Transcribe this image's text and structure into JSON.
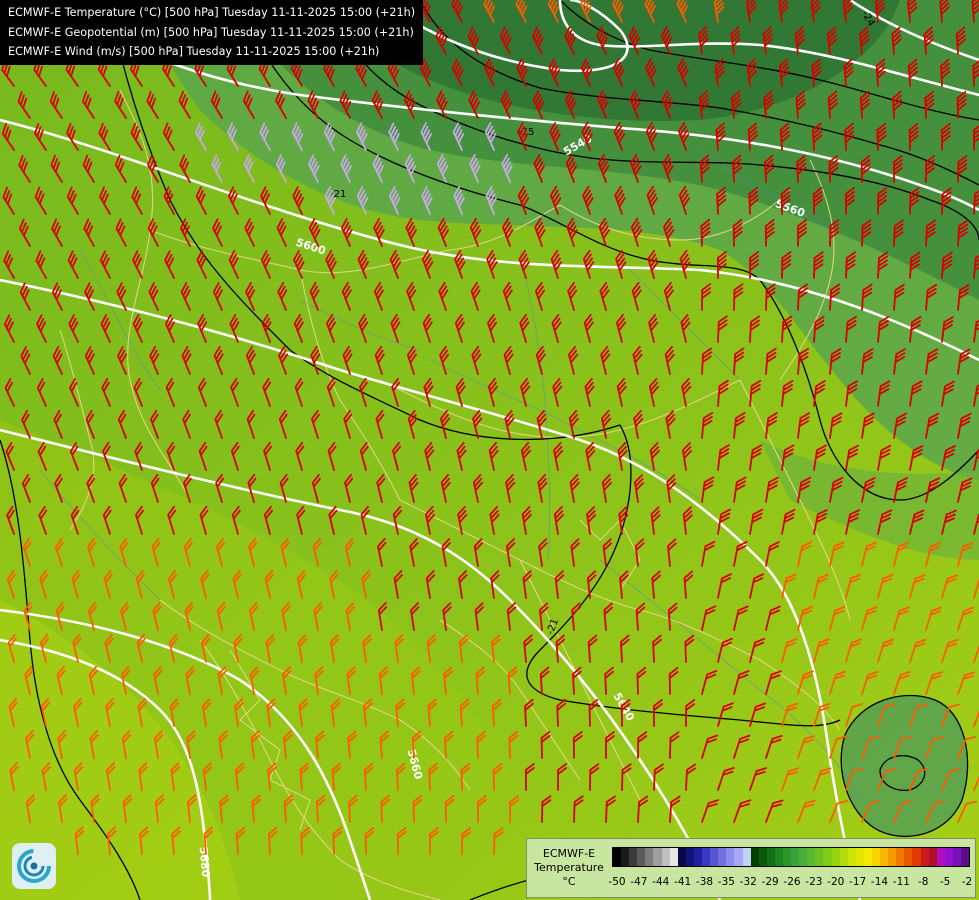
{
  "titles": [
    "ECMWF-E Temperature (°C) [500 hPa] Tuesday 11-11-2025 15:00 (+21h)",
    "ECMWF-E Geopotential (m) [500 hPa] Tuesday 11-11-2025 15:00 (+21h)",
    "ECMWF-E Wind (m/s) [500 hPa] Tuesday 11-11-2025 15:00 (+21h)"
  ],
  "contour_labels": {
    "geopotential": [
      "5540",
      "5560",
      "5600",
      "5640",
      "5660",
      "5680"
    ],
    "temperature": [
      "-21",
      "-25",
      "-24",
      "-21"
    ]
  },
  "legend": {
    "label_lines": [
      "ECMWF-E",
      "Temperature",
      "°C"
    ],
    "ticks": [
      "-50",
      "-47",
      "-44",
      "-41",
      "-38",
      "-35",
      "-32",
      "-29",
      "-26",
      "-23",
      "-20",
      "-17",
      "-14",
      "-11",
      "-8",
      "-5",
      "-2"
    ],
    "colors": [
      "#000000",
      "#1a1a1a",
      "#3a3a3a",
      "#5c5c5c",
      "#7d7d7d",
      "#9e9e9e",
      "#bfbfbf",
      "#e6e6e6",
      "#08084a",
      "#141478",
      "#2020a0",
      "#3838c0",
      "#5555d5",
      "#7070e0",
      "#8c8cec",
      "#a8a8f4",
      "#c0d4f8",
      "#004000",
      "#0a5a0a",
      "#137013",
      "#1e851e",
      "#2b972b",
      "#3aa33a",
      "#4aae3a",
      "#5ab82e",
      "#6ac224",
      "#7fcc18",
      "#98d410",
      "#b4dc0a",
      "#cce20a",
      "#e4e600",
      "#f2ea00",
      "#f8d400",
      "#f6b800",
      "#f49a00",
      "#f07a00",
      "#e85800",
      "#e03a00",
      "#c81a1a",
      "#b0102c",
      "#b010c0",
      "#9410d0",
      "#7a10b8",
      "#5c0a90"
    ]
  },
  "logo": {
    "icon": "ecmwf-spiral-logo"
  },
  "colors": {
    "barb_red": "#d90000",
    "barb_orange": "#ff5a00",
    "barb_lilac": "#c8a8e8",
    "contour_white": "#ffffff",
    "contour_black": "#000000",
    "coast": "#f0d890"
  }
}
